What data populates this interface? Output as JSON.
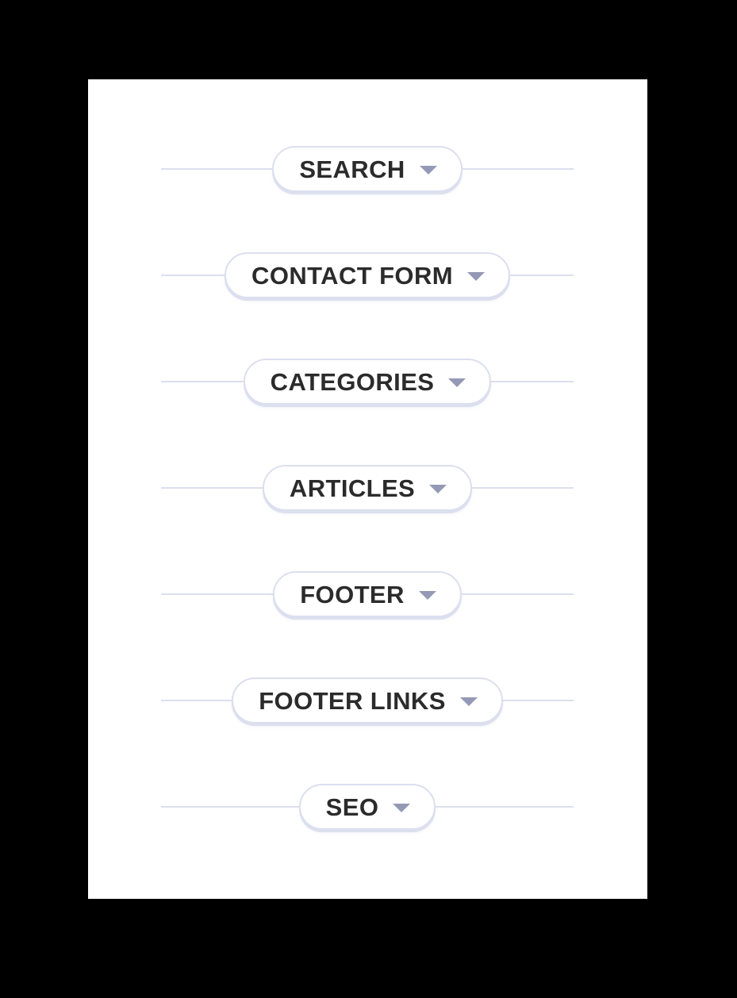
{
  "page": {
    "background_color": "#000000",
    "card_background": "#ffffff"
  },
  "theme": {
    "line_color": "#dcdfee",
    "pill_border_color": "#dcdfee",
    "pill_background": "#ffffff",
    "label_color": "#2b2b2b",
    "caret_color": "#9499b5"
  },
  "accordion": {
    "sections": [
      {
        "label": "SEARCH",
        "icon": "chevron-down-icon",
        "expanded": false
      },
      {
        "label": "CONTACT FORM",
        "icon": "chevron-down-icon",
        "expanded": false
      },
      {
        "label": "CATEGORIES",
        "icon": "chevron-down-icon",
        "expanded": false
      },
      {
        "label": "ARTICLES",
        "icon": "chevron-down-icon",
        "expanded": false
      },
      {
        "label": "FOOTER",
        "icon": "chevron-down-icon",
        "expanded": false
      },
      {
        "label": "FOOTER LINKS",
        "icon": "chevron-down-icon",
        "expanded": false
      },
      {
        "label": "SEO",
        "icon": "chevron-down-icon",
        "expanded": false
      }
    ]
  }
}
